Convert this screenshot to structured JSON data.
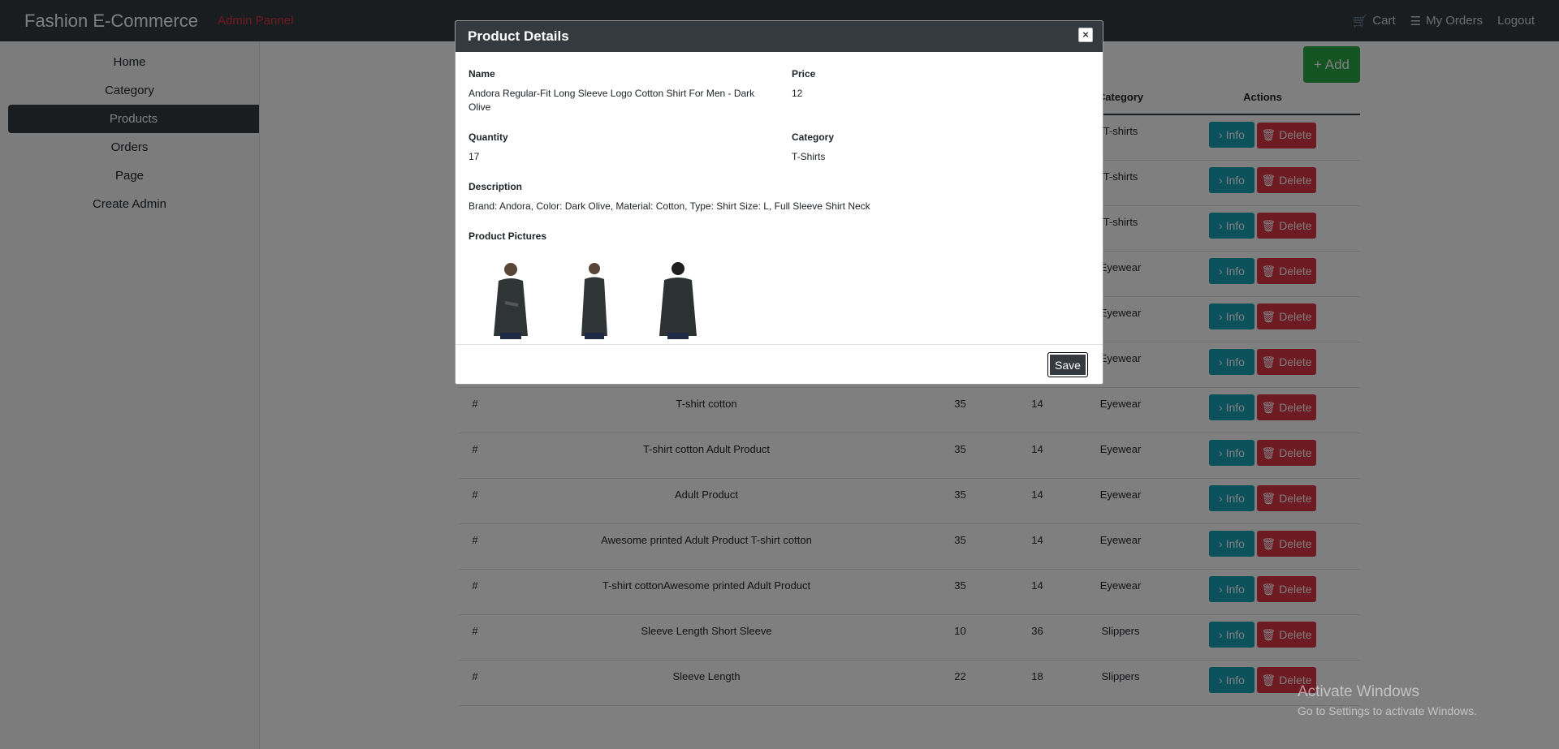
{
  "topbar": {
    "brand": "Fashion E-Commerce",
    "admin_label": "Admin Pannel",
    "cart": "Cart",
    "orders": "My Orders",
    "logout": "Logout"
  },
  "sidebar": {
    "items": [
      {
        "label": "Home"
      },
      {
        "label": "Category"
      },
      {
        "label": "Products"
      },
      {
        "label": "Orders"
      },
      {
        "label": "Page"
      },
      {
        "label": "Create Admin"
      }
    ]
  },
  "toolbar": {
    "add_label": "+ Add"
  },
  "table": {
    "headers": {
      "category": "Category",
      "actions": "Actions"
    },
    "rows": [
      {
        "id": "",
        "name": "",
        "price": "",
        "qty": "",
        "category": "T-shirts"
      },
      {
        "id": "",
        "name": "",
        "price": "",
        "qty": "",
        "category": "T-shirts"
      },
      {
        "id": "",
        "name": "",
        "price": "",
        "qty": "",
        "category": "T-shirts"
      },
      {
        "id": "",
        "name": "",
        "price": "",
        "qty": "",
        "category": "Eyewear"
      },
      {
        "id": "",
        "name": "",
        "price": "",
        "qty": "",
        "category": "Eyewear"
      },
      {
        "id": "",
        "name": "",
        "price": "",
        "qty": "",
        "category": "Eyewear"
      },
      {
        "id": "#",
        "name": "T-shirt cotton",
        "price": "35",
        "qty": "14",
        "category": "Eyewear"
      },
      {
        "id": "#",
        "name": "T-shirt cotton Adult Product",
        "price": "35",
        "qty": "14",
        "category": "Eyewear"
      },
      {
        "id": "#",
        "name": "Adult Product",
        "price": "35",
        "qty": "14",
        "category": "Eyewear"
      },
      {
        "id": "#",
        "name": "Awesome printed Adult Product T-shirt cotton",
        "price": "35",
        "qty": "14",
        "category": "Eyewear"
      },
      {
        "id": "#",
        "name": "T-shirt cottonAwesome printed Adult Product",
        "price": "35",
        "qty": "14",
        "category": "Eyewear"
      },
      {
        "id": "#",
        "name": "Sleeve Length Short Sleeve",
        "price": "10",
        "qty": "36",
        "category": "Slippers"
      },
      {
        "id": "#",
        "name": "Sleeve Length",
        "price": "22",
        "qty": "18",
        "category": "Slippers"
      }
    ],
    "info_label": "› Info",
    "delete_label": "🗑 Delete"
  },
  "modal": {
    "title": "Product Details",
    "close": "×",
    "name_label": "Name",
    "name_value": "Andora Regular-Fit Long Sleeve Logo Cotton Shirt For Men - Dark Olive",
    "price_label": "Price",
    "price_value": "12",
    "quantity_label": "Quantity",
    "quantity_value": "17",
    "category_label": "Category",
    "category_value": "T-Shirts",
    "description_label": "Description",
    "description_value": "Brand: Andora, Color: Dark Olive, Material: Cotton, Type: Shirt Size: L, Full Sleeve Shirt Neck",
    "pictures_label": "Product Pictures",
    "save_label": "Save"
  },
  "watermark": {
    "line1": "Activate Windows",
    "line2": "Go to Settings to activate Windows."
  }
}
